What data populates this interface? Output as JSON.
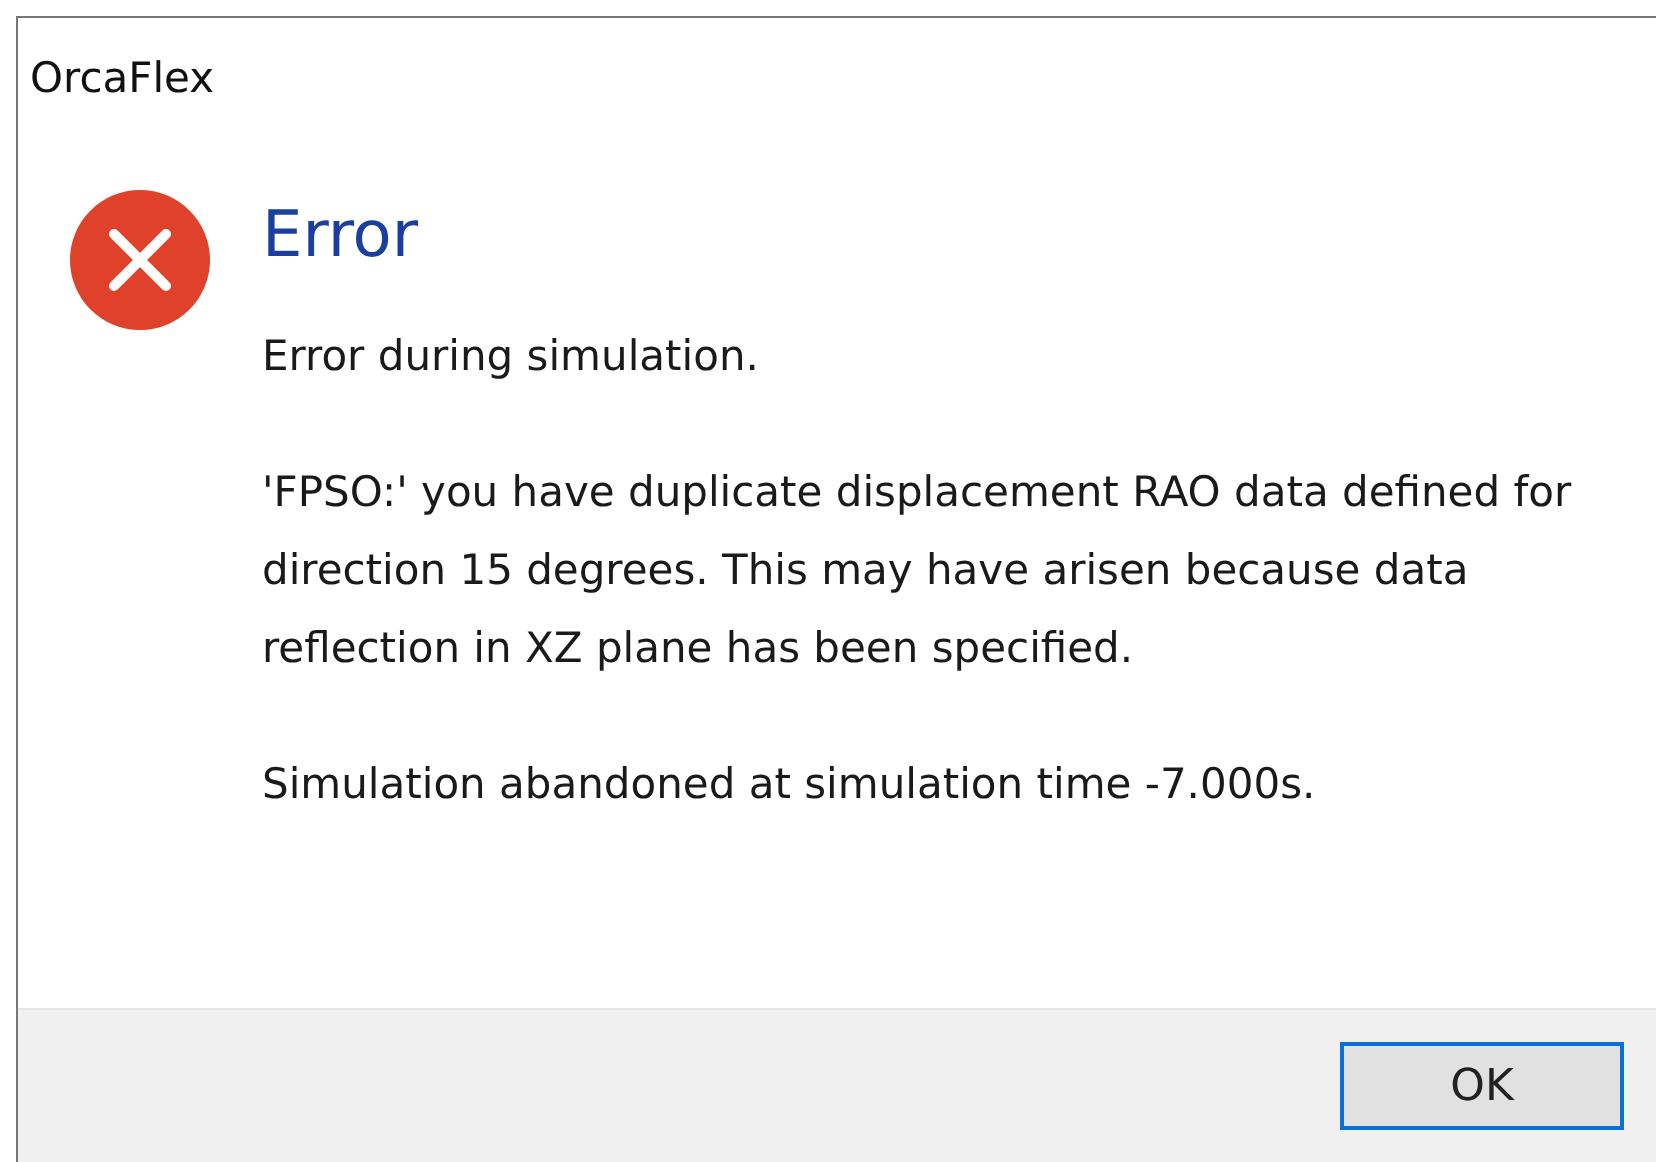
{
  "window": {
    "title": "OrcaFlex"
  },
  "dialog": {
    "heading": "Error",
    "paragraphs": [
      "Error during simulation.",
      "'FPSO:' you have duplicate displacement RAO data defined for direction 15 degrees.  This may have arisen because data reflection in XZ plane has been specified.",
      "Simulation abandoned at simulation time -7.000s."
    ]
  },
  "buttons": [
    {
      "label": "OK",
      "focused": true
    }
  ]
}
